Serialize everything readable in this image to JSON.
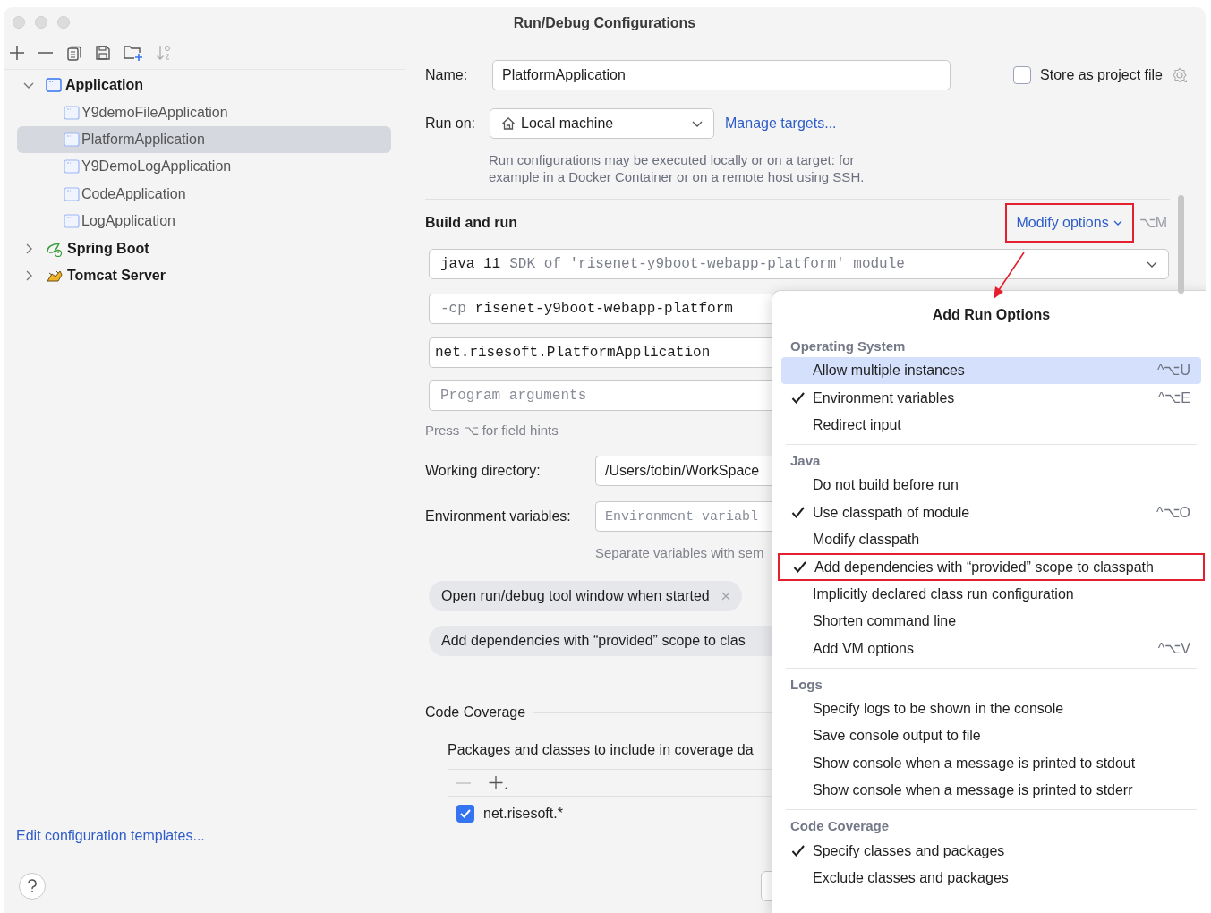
{
  "window": {
    "title": "Run/Debug Configurations"
  },
  "sidebar": {
    "tree": [
      {
        "label": "Application",
        "kind": "application",
        "expanded": true,
        "selected": false,
        "children": [
          {
            "label": "Y9demoFileApplication",
            "kind": "class",
            "selected": false
          },
          {
            "label": "PlatformApplication",
            "kind": "class",
            "selected": true
          },
          {
            "label": "Y9DemoLogApplication",
            "kind": "class",
            "selected": false
          },
          {
            "label": "CodeApplication",
            "kind": "class",
            "selected": false
          },
          {
            "label": "LogApplication",
            "kind": "class",
            "selected": false
          }
        ]
      },
      {
        "label": "Spring Boot",
        "kind": "spring",
        "expanded": false,
        "selected": false
      },
      {
        "label": "Tomcat Server",
        "kind": "tomcat",
        "expanded": false,
        "selected": false
      }
    ],
    "footer_link": "Edit configuration templates..."
  },
  "form": {
    "name_label": "Name:",
    "name_value": "PlatformApplication",
    "store_label": "Store as project file",
    "store_checked": false,
    "run_on_label": "Run on:",
    "run_on_value": "Local machine",
    "manage_link": "Manage targets...",
    "run_on_note": "Run configurations may be executed locally or on a target: for example in a Docker Container or on a remote host using SSH.",
    "build_title": "Build and run",
    "modify_label": "Modify options",
    "modify_shortcut": "⌥M",
    "modify_outlined": true,
    "sdk": {
      "value": "java 11",
      "hint": "SDK of 'risenet-y9boot-webapp-platform' module"
    },
    "classpath": {
      "prefix": "-cp",
      "value": "risenet-y9boot-webapp-platform"
    },
    "main_class": "net.risesoft.PlatformApplication",
    "program_args_placeholder": "Program arguments",
    "field_hint": "Press ⌥ for field hints",
    "workdir_label": "Working directory:",
    "workdir_value": "/Users/tobin/WorkSpace",
    "env_label": "Environment variables:",
    "env_placeholder": "Environment variabl",
    "env_note": "Separate variables with sem",
    "chips": [
      {
        "label": "Open run/debug tool window when started",
        "removable": true
      },
      {
        "label": "Add dependencies with “provided” scope to clas",
        "removable": false
      }
    ],
    "coverage": {
      "title": "Code Coverage",
      "note": "Packages and classes to include in coverage da",
      "patterns": [
        {
          "label": "net.risesoft.*",
          "checked": true
        }
      ]
    }
  },
  "annotation_arrow": true,
  "popup": {
    "title": "Add Run Options",
    "sections": [
      {
        "title": "Operating System",
        "items": [
          {
            "label": "Allow multiple instances",
            "checked": false,
            "selected": true,
            "shortcut": "^⌥U"
          },
          {
            "label": "Environment variables",
            "checked": true,
            "selected": false,
            "shortcut": "^⌥E"
          },
          {
            "label": "Redirect input",
            "checked": false,
            "selected": false
          }
        ]
      },
      {
        "title": "Java",
        "items": [
          {
            "label": "Do not build before run",
            "checked": false,
            "selected": false
          },
          {
            "label": "Use classpath of module",
            "checked": true,
            "selected": false,
            "shortcut": "^⌥O"
          },
          {
            "label": "Modify classpath",
            "checked": false,
            "selected": false
          },
          {
            "label": "Add dependencies with “provided” scope to classpath",
            "checked": true,
            "selected": false,
            "outlined": true
          },
          {
            "label": "Implicitly declared class run configuration",
            "checked": false,
            "selected": false
          },
          {
            "label": "Shorten command line",
            "checked": false,
            "selected": false
          },
          {
            "label": "Add VM options",
            "checked": false,
            "selected": false,
            "shortcut": "^⌥V"
          }
        ]
      },
      {
        "title": "Logs",
        "items": [
          {
            "label": "Specify logs to be shown in the console",
            "checked": false,
            "selected": false
          },
          {
            "label": "Save console output to file",
            "checked": false,
            "selected": false
          },
          {
            "label": "Show console when a message is printed to stdout",
            "checked": false,
            "selected": false
          },
          {
            "label": "Show console when a message is printed to stderr",
            "checked": false,
            "selected": false
          }
        ]
      },
      {
        "title": "Code Coverage",
        "items": [
          {
            "label": "Specify classes and packages",
            "checked": true,
            "selected": false
          },
          {
            "label": "Exclude classes and packages",
            "checked": false,
            "selected": false
          }
        ]
      }
    ]
  }
}
